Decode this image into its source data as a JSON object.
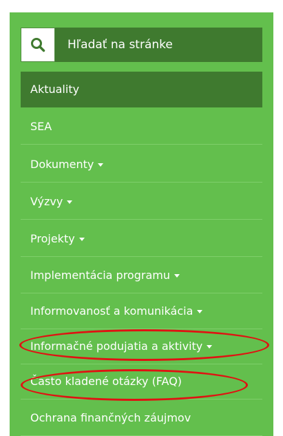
{
  "search": {
    "placeholder": "Hľadať na stránke"
  },
  "nav": {
    "items": [
      {
        "label": "Aktuality"
      },
      {
        "label": "SEA"
      },
      {
        "label": "Dokumenty"
      },
      {
        "label": "Výzvy"
      },
      {
        "label": "Projekty"
      },
      {
        "label": "Implementácia programu"
      },
      {
        "label": "Informovanosť a komunikácia"
      },
      {
        "label": "Informačné podujatia a aktivity"
      },
      {
        "label": "Často kladené otázky (FAQ)"
      },
      {
        "label": "Ochrana finančných záujmov"
      }
    ]
  },
  "colors": {
    "panel_background": "#63bf4d",
    "active_background": "#3f7a2f",
    "highlight_ring": "#e01212"
  },
  "icons": {
    "search": "search-icon",
    "dropdown": "caret-down-icon"
  }
}
